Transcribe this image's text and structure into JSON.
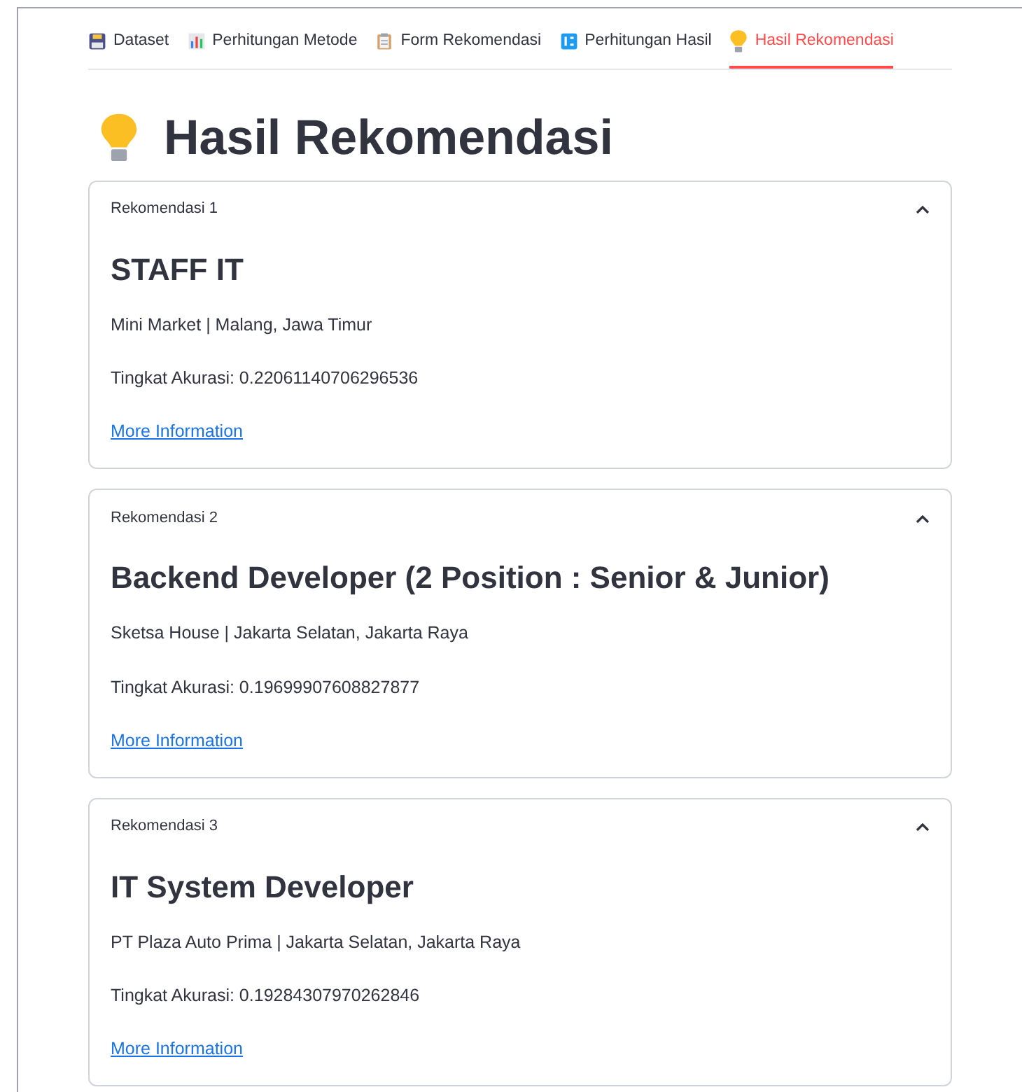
{
  "tabs": [
    {
      "label": "Dataset",
      "selected": false
    },
    {
      "label": "Perhitungan Metode",
      "selected": false
    },
    {
      "label": "Form Rekomendasi",
      "selected": false
    },
    {
      "label": "Perhitungan Hasil",
      "selected": false
    },
    {
      "label": "Hasil Rekomendasi",
      "selected": true
    }
  ],
  "title": "Hasil Rekomendasi",
  "recommendations": [
    {
      "label": "Rekomendasi 1",
      "expanded": true,
      "job_title": "STAFF IT",
      "company_location": "Mini Market | Malang, Jawa Timur",
      "accuracy": "Tingkat Akurasi: 0.22061140706296536",
      "link": "More Information"
    },
    {
      "label": "Rekomendasi 2",
      "expanded": true,
      "job_title": "Backend Developer (2 Position : Senior & Junior)",
      "company_location": "Sketsa House | Jakarta Selatan, Jakarta Raya",
      "accuracy": "Tingkat Akurasi: 0.19699907608827877",
      "link": "More Information"
    },
    {
      "label": "Rekomendasi 3",
      "expanded": true,
      "job_title": "IT System Developer",
      "company_location": "PT Plaza Auto Prima | Jakarta Selatan, Jakarta Raya",
      "accuracy": "Tingkat Akurasi: 0.19284307970262846",
      "link": "More Information"
    }
  ]
}
